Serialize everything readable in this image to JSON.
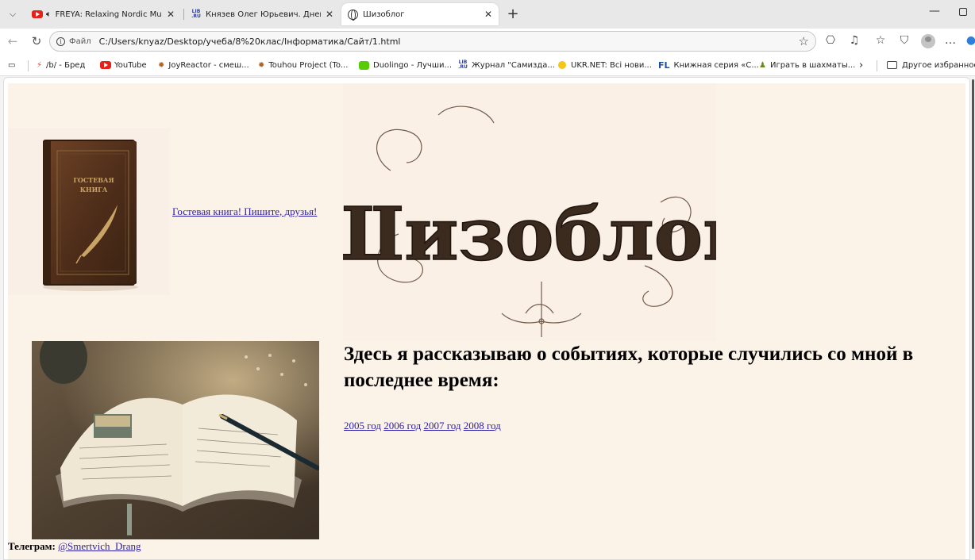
{
  "tabs": [
    {
      "title": "FREYA: Relaxing Nordic Music",
      "icon": "youtube-icon"
    },
    {
      "title": "Князев Олег Юрьевич. Дневник",
      "icon": "lib-ru-icon"
    },
    {
      "title": "Шизоблог",
      "icon": "globe-icon",
      "active": true
    }
  ],
  "address": {
    "file_label": "Файл",
    "url": "C:/Users/knyaz/Desktop/учеба/8%20клас/Інформатика/Сайт/1.html"
  },
  "bookmarks": [
    {
      "label": "/b/ - Бред"
    },
    {
      "label": "YouTube"
    },
    {
      "label": "JoyReactor - смеш..."
    },
    {
      "label": "Touhou Project (To..."
    },
    {
      "label": "Duolingo - Лучши..."
    },
    {
      "label": "Журнал \"Самизда..."
    },
    {
      "label": "UKR.NET: Всі нови..."
    },
    {
      "label": "Книжная серия «С..."
    },
    {
      "label": "Играть в шахматы..."
    }
  ],
  "bookmarks_other": "Другое избранное",
  "page": {
    "guestbook_cover_title": "ГОСТЕВАЯ КНИГА",
    "guestbook_link": "Гостевая книга! Пишите, друзья!",
    "logo_text": "Шизоблог",
    "heading": "Здесь я рассказываю о событиях, которые случились со мной в последнее время:",
    "years": [
      "2005 год",
      "2006 год",
      "2007 год",
      "2008 год"
    ],
    "telegram_label": "Телеграм:",
    "telegram_handle": "@Smertvich_Drang"
  },
  "colors": {
    "page_bg": "#fbf2e8",
    "link": "#2d1fa3",
    "book_leather": "#5a3520",
    "logo_ink": "#3b2a1e"
  }
}
